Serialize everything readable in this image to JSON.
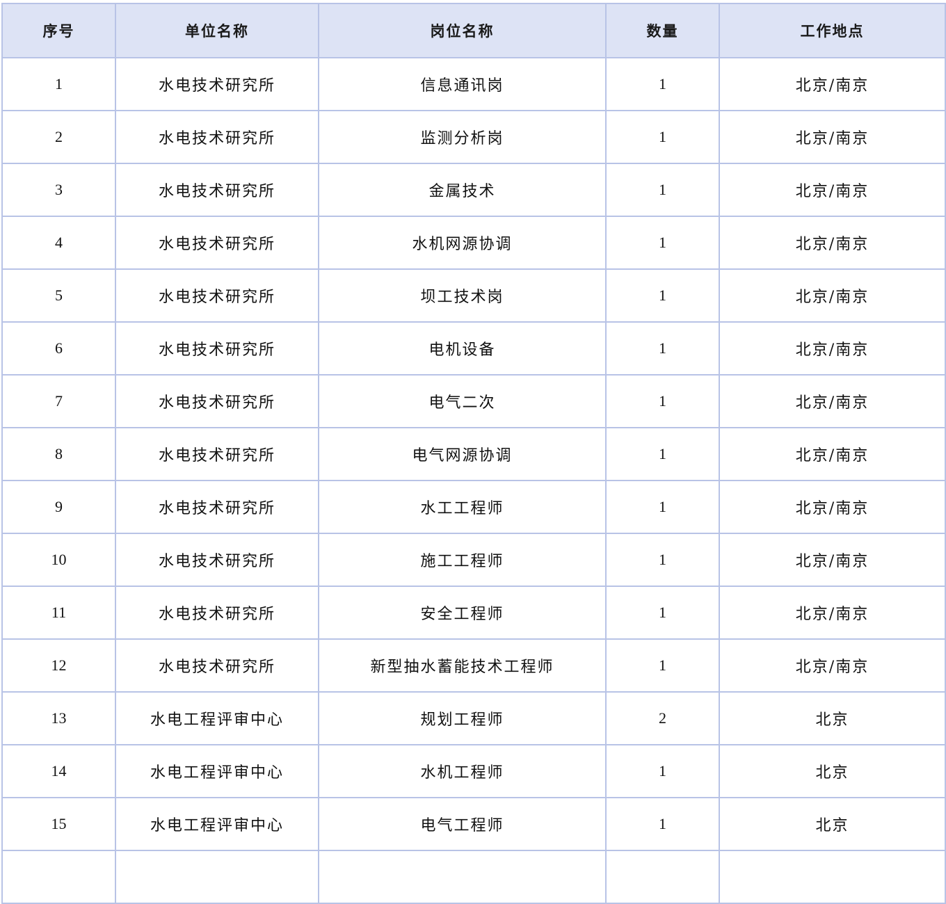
{
  "table": {
    "headers": [
      "序号",
      "单位名称",
      "岗位名称",
      "数量",
      "工作地点"
    ],
    "rows": [
      [
        "1",
        "水电技术研究所",
        "信息通讯岗",
        "1",
        "北京/南京"
      ],
      [
        "2",
        "水电技术研究所",
        "监测分析岗",
        "1",
        "北京/南京"
      ],
      [
        "3",
        "水电技术研究所",
        "金属技术",
        "1",
        "北京/南京"
      ],
      [
        "4",
        "水电技术研究所",
        "水机网源协调",
        "1",
        "北京/南京"
      ],
      [
        "5",
        "水电技术研究所",
        "坝工技术岗",
        "1",
        "北京/南京"
      ],
      [
        "6",
        "水电技术研究所",
        "电机设备",
        "1",
        "北京/南京"
      ],
      [
        "7",
        "水电技术研究所",
        "电气二次",
        "1",
        "北京/南京"
      ],
      [
        "8",
        "水电技术研究所",
        "电气网源协调",
        "1",
        "北京/南京"
      ],
      [
        "9",
        "水电技术研究所",
        "水工工程师",
        "1",
        "北京/南京"
      ],
      [
        "10",
        "水电技术研究所",
        "施工工程师",
        "1",
        "北京/南京"
      ],
      [
        "11",
        "水电技术研究所",
        "安全工程师",
        "1",
        "北京/南京"
      ],
      [
        "12",
        "水电技术研究所",
        "新型抽水蓄能技术工程师",
        "1",
        "北京/南京"
      ],
      [
        "13",
        "水电工程评审中心",
        "规划工程师",
        "2",
        "北京"
      ],
      [
        "14",
        "水电工程评审中心",
        "水机工程师",
        "1",
        "北京"
      ],
      [
        "15",
        "水电工程评审中心",
        "电气工程师",
        "1",
        "北京"
      ]
    ]
  },
  "colors": {
    "header_bg": "#dde3f5",
    "border": "#b8c3e6"
  }
}
